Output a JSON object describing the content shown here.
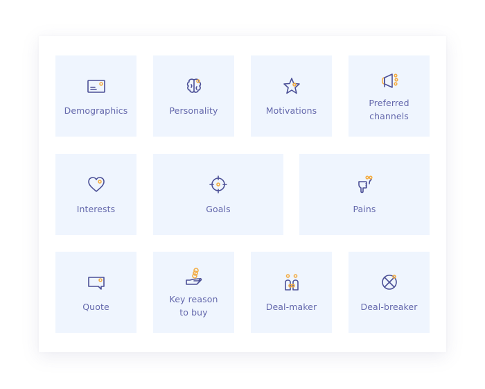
{
  "colors": {
    "tile_background": "#eff5fe",
    "label": "#6468ac",
    "icon_stroke": "#4b4f96",
    "icon_accent": "#f3ad45"
  },
  "tiles": [
    {
      "label": "Demographics",
      "icon": "id-card-icon"
    },
    {
      "label": "Personality",
      "icon": "brain-icon"
    },
    {
      "label": "Motivations",
      "icon": "star-icon"
    },
    {
      "label": "Preferred\nchannels",
      "icon": "megaphone-icon"
    },
    {
      "label": "Interests",
      "icon": "heart-icon"
    },
    {
      "label": "Goals",
      "icon": "target-icon"
    },
    {
      "label": "Pains",
      "icon": "thumbs-down-icon"
    },
    {
      "label": "Quote",
      "icon": "speech-bubble-icon"
    },
    {
      "label": "Key reason\nto buy",
      "icon": "hand-coins-icon"
    },
    {
      "label": "Deal-maker",
      "icon": "handshake-people-icon"
    },
    {
      "label": "Deal-breaker",
      "icon": "cross-circle-icon"
    }
  ]
}
